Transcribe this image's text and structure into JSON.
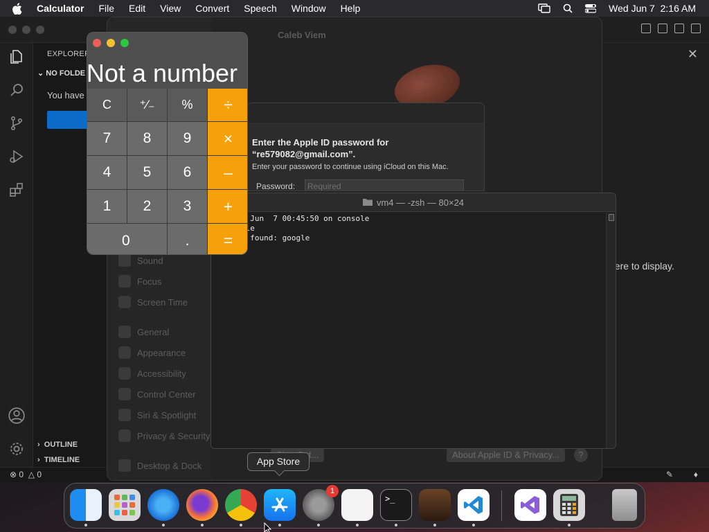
{
  "menubar": {
    "apple_icon": "apple-icon",
    "app_name": "Calculator",
    "menus": [
      "File",
      "Edit",
      "View",
      "Convert",
      "Speech",
      "Window",
      "Help"
    ],
    "clock": "Wed Jun 7  2:16 AM",
    "status_icons": [
      "screen-mirroring-icon",
      "spotlight-search-icon",
      "control-center-icon"
    ]
  },
  "vscode": {
    "explorer_title": "EXPLORER",
    "folder_header": "NO FOLDE",
    "no_folder_text": "You have",
    "outline_label": "OUTLINE",
    "timeline_label": "TIMELINE",
    "editor_message": "here to display.",
    "status_errors": "0",
    "status_warnings": "0",
    "accent": "#0a6bc9"
  },
  "settings": {
    "user_name": "Caleb Viem",
    "sidebar_items": [
      "Sound",
      "Focus",
      "Screen Time",
      "General",
      "Appearance",
      "Accessibility",
      "Control Center",
      "Siri & Spotlight",
      "Privacy & Security",
      "Desktop & Dock"
    ],
    "bottom_button_left": "Sign Out...",
    "bottom_button_right": "About Apple ID & Privacy...",
    "help_button": "?"
  },
  "apple_id_sheet": {
    "heading": "Enter the Apple ID password for “re579082@gmail.com”.",
    "subtext": "Enter your password to continue using iCloud on this Mac.",
    "password_label": "Password:",
    "password_placeholder": "Required"
  },
  "terminal": {
    "title": "vm4 — -zsh — 80×24",
    "lines": [
      "ogin: Wed Jun  7 00:45:50 on console",
      " ~ % google",
      "mmand not found: google",
      " ~ % "
    ]
  },
  "calculator": {
    "display": "Not a number",
    "keys": [
      {
        "label": "C",
        "kind": "fn"
      },
      {
        "label": "⁺∕₋",
        "kind": "fn"
      },
      {
        "label": "%",
        "kind": "fn"
      },
      {
        "label": "÷",
        "kind": "op"
      },
      {
        "label": "7",
        "kind": "num"
      },
      {
        "label": "8",
        "kind": "num"
      },
      {
        "label": "9",
        "kind": "num"
      },
      {
        "label": "×",
        "kind": "op"
      },
      {
        "label": "4",
        "kind": "num"
      },
      {
        "label": "5",
        "kind": "num"
      },
      {
        "label": "6",
        "kind": "num"
      },
      {
        "label": "–",
        "kind": "op"
      },
      {
        "label": "1",
        "kind": "num"
      },
      {
        "label": "2",
        "kind": "num"
      },
      {
        "label": "3",
        "kind": "num"
      },
      {
        "label": "+",
        "kind": "op"
      },
      {
        "label": "0",
        "kind": "num"
      },
      {
        "label": ".",
        "kind": "num"
      },
      {
        "label": "=",
        "kind": "op"
      }
    ],
    "accent": "#f6a10a"
  },
  "dock": {
    "tooltip": "App Store",
    "items": [
      {
        "name": "finder",
        "icon": "finder-icon",
        "running": true
      },
      {
        "name": "launchpad",
        "icon": "launchpad-icon",
        "running": false
      },
      {
        "name": "safari",
        "icon": "safari-icon",
        "running": true
      },
      {
        "name": "firefox",
        "icon": "firefox-icon",
        "running": true
      },
      {
        "name": "chrome",
        "icon": "chrome-icon",
        "running": true
      },
      {
        "name": "app-store",
        "icon": "app-store-icon",
        "running": true
      },
      {
        "name": "system-settings",
        "icon": "system-settings-icon",
        "running": true,
        "badge": "1"
      },
      {
        "name": "textedit",
        "icon": "textedit-icon",
        "running": true
      },
      {
        "name": "terminal",
        "icon": "terminal-icon",
        "running": true
      },
      {
        "name": "garageband",
        "icon": "garageband-icon",
        "running": true
      },
      {
        "name": "vscode",
        "icon": "vscode-icon",
        "running": true
      },
      {
        "name": "visual-studio",
        "icon": "visual-studio-icon",
        "running": false
      },
      {
        "name": "calculator",
        "icon": "calculator-icon",
        "running": true
      },
      {
        "name": "trash",
        "icon": "trash-icon",
        "running": false
      }
    ]
  }
}
